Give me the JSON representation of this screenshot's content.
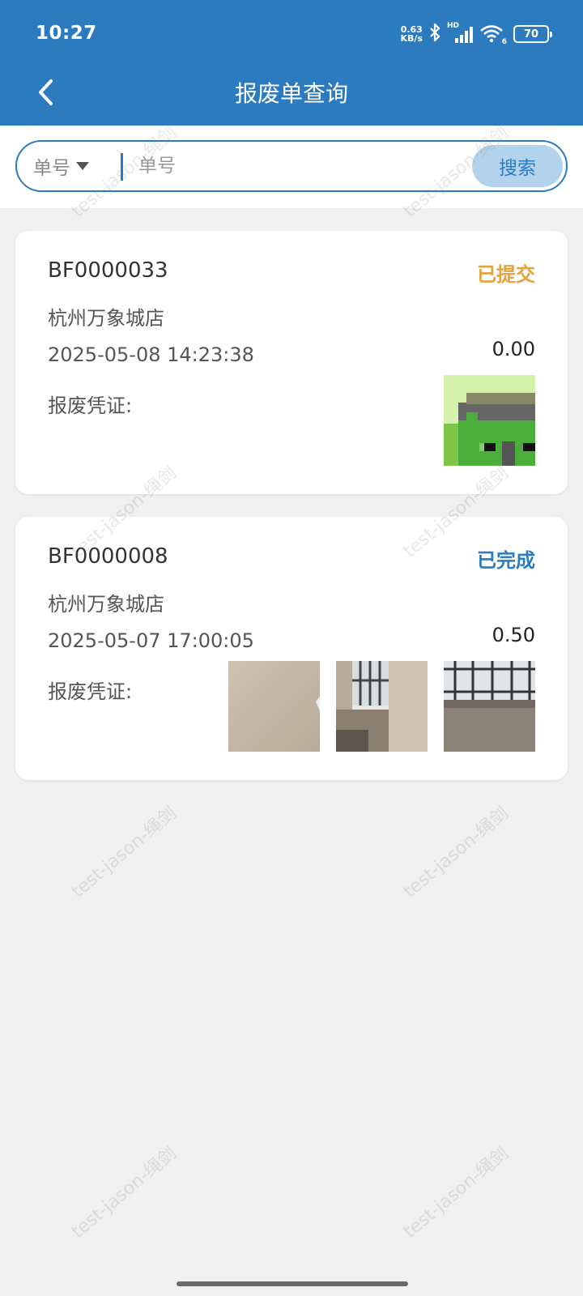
{
  "status_bar": {
    "time": "10:27",
    "net_speed_value": "0.63",
    "net_speed_unit": "KB/s",
    "network_label": "HD",
    "wifi_label": "6",
    "battery": "70"
  },
  "nav": {
    "title": "报废单查询",
    "back_icon": "chevron-left-icon"
  },
  "search": {
    "type_label": "单号",
    "placeholder": "单号",
    "value": "",
    "button_label": "搜索"
  },
  "voucher_label": "报废凭证:",
  "orders": [
    {
      "order_no": "BF0000033",
      "status": "已提交",
      "status_color": "#e6a23c",
      "store": "杭州万象城店",
      "datetime": "2025-05-08 14:23:38",
      "amount": "0.00",
      "thumb_count": 1
    },
    {
      "order_no": "BF0000008",
      "status": "已完成",
      "status_color": "#2c7bbf",
      "store": "杭州万象城店",
      "datetime": "2025-05-07 17:00:05",
      "amount": "0.50",
      "thumb_count": 3
    }
  ],
  "watermark_text": "test-jason-绳剑",
  "colors": {
    "primary": "#2c7bbf",
    "background": "#f0f0f0"
  }
}
